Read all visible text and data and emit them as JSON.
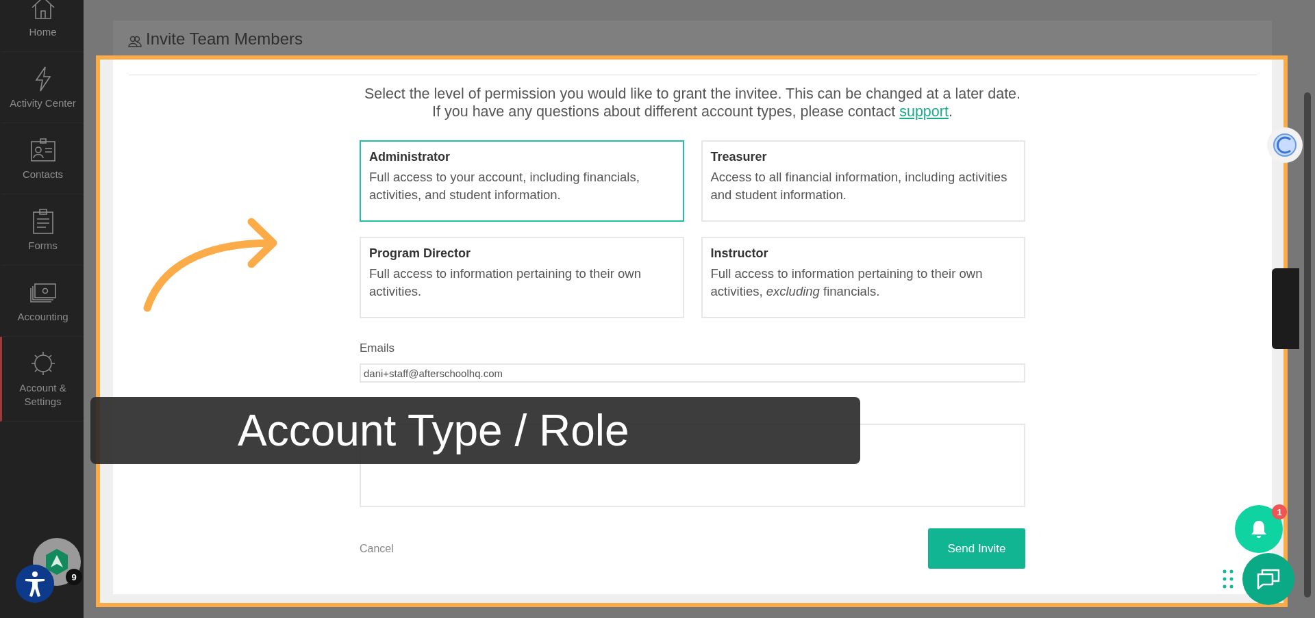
{
  "sidebar": {
    "items": [
      {
        "label": "Home",
        "kind": "home",
        "selected": false
      },
      {
        "label": "Activity Center",
        "kind": "bolt",
        "selected": false
      },
      {
        "label": "Contacts",
        "kind": "contact",
        "selected": false
      },
      {
        "label": "Forms",
        "kind": "clipboard",
        "selected": false
      },
      {
        "label": "Accounting",
        "kind": "money",
        "selected": false
      },
      {
        "label": "Account & Settings",
        "kind": "gear",
        "selected": true
      }
    ],
    "avatar_badge": "9"
  },
  "panel": {
    "title": "Invite Team Members"
  },
  "intro": {
    "line_1": "Select the level of permission you would like to grant the invitee. This can be changed at a later date.",
    "line_2": "If you have any questions about different account types, please contact ",
    "link": "support",
    "line_2_end": "."
  },
  "roles": [
    {
      "title": "Administrator",
      "description": "Full access to your account, including financials, activities, and student information.",
      "selected": true
    },
    {
      "title": "Treasurer",
      "description": "Access to all financial information, including activities and student information.",
      "selected": false
    },
    {
      "title": "Program Director",
      "description": "Full access to information pertaining to their own activities.",
      "selected": false
    },
    {
      "title": "Instructor",
      "description": "Full access to information pertaining to their own activities, *excluding* financials.",
      "selected": false
    }
  ],
  "emails": {
    "label": "Emails",
    "value": "dani+staff@afterschoolhq.com"
  },
  "actions": {
    "cancel": "Cancel",
    "submit": "Send Invite"
  },
  "notifications": {
    "badge": "1"
  },
  "caption": "Account Type / Role"
}
